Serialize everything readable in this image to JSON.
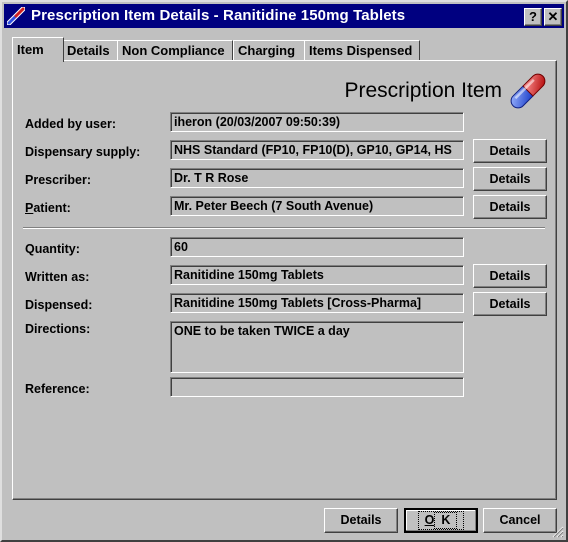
{
  "window": {
    "title": "Prescription Item Details - Ranitidine 150mg Tablets",
    "help_label": "?",
    "close_label": "✕"
  },
  "tabs": [
    {
      "label": "Item",
      "active": true
    },
    {
      "label": "Details"
    },
    {
      "label": "Non Compliance"
    },
    {
      "label": "Charging"
    },
    {
      "label": "Items Dispensed"
    }
  ],
  "panel": {
    "header": "Prescription Item",
    "icon": "capsule-icon"
  },
  "fields": {
    "added_by_user": {
      "label": "Added by user:",
      "value": "iheron  (20/03/2007 09:50:39)"
    },
    "dispensary_supply": {
      "label": "Dispensary supply:",
      "value": "NHS Standard (FP10, FP10(D), GP10, GP14, HS"
    },
    "prescriber": {
      "label": "Prescriber:",
      "value": "Dr. T R Rose"
    },
    "patient": {
      "label_prefix": "P",
      "label_rest": "atient:",
      "value": "Mr. Peter Beech (7 South Avenue)"
    },
    "quantity": {
      "label": "Quantity:",
      "value": "60"
    },
    "written_as": {
      "label": "Written as:",
      "value": "Ranitidine 150mg Tablets"
    },
    "dispensed": {
      "label": "Dispensed:",
      "value": "Ranitidine 150mg Tablets [Cross-Pharma]"
    },
    "directions": {
      "label": "Directions:",
      "value": "ONE to be taken TWICE a day"
    },
    "reference": {
      "label": "Reference:",
      "value": ""
    }
  },
  "buttons": {
    "details": "Details",
    "ok_prefix": "O",
    "ok_rest": "K",
    "cancel": "Cancel"
  },
  "colors": {
    "titlebar": "#000080",
    "face": "#c0c0c0"
  }
}
